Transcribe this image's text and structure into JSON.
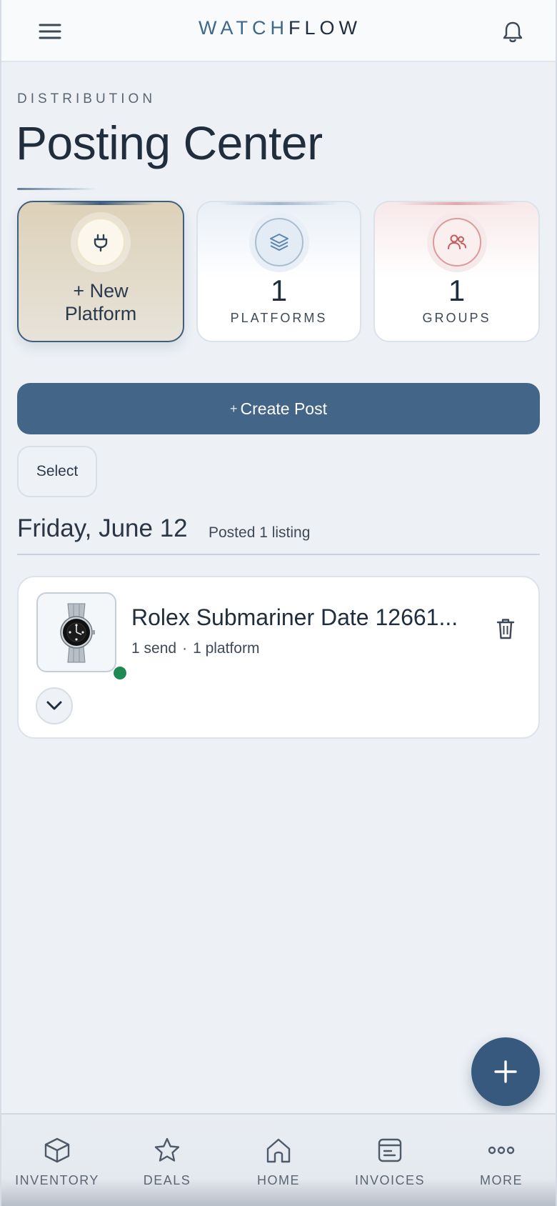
{
  "header": {
    "brand_part1": "WATCH",
    "brand_part2": "FLOW",
    "menu_icon": "hamburger-menu-icon",
    "notification_icon": "bell-icon"
  },
  "page": {
    "eyebrow": "DISTRIBUTION",
    "title": "Posting Center"
  },
  "stats": {
    "new_platform_label_line1": "+ New",
    "new_platform_label_line2": "Platform",
    "platforms_count": "1",
    "platforms_label": "PLATFORMS",
    "groups_count": "1",
    "groups_label": "GROUPS"
  },
  "actions": {
    "create_post_plus": "+",
    "create_post_label": "Create Post",
    "select_label": "Select"
  },
  "day_group": {
    "date": "Friday, June 12",
    "summary": "Posted 1 listing"
  },
  "listings": [
    {
      "title": "Rolex Submariner Date 12661...",
      "sends": "1 send",
      "separator": "·",
      "platforms": "1 platform",
      "status_color": "#1e8a52"
    }
  ],
  "bottom_nav": [
    {
      "label": "INVENTORY",
      "icon": "box-icon"
    },
    {
      "label": "DEALS",
      "icon": "star-icon"
    },
    {
      "label": "HOME",
      "icon": "home-icon"
    },
    {
      "label": "INVOICES",
      "icon": "invoice-icon"
    },
    {
      "label": "MORE",
      "icon": "more-dots-icon"
    }
  ],
  "colors": {
    "accent": "#426588",
    "fab": "#36597d",
    "groups_accent": "#c85a5a",
    "platforms_accent": "#5f86ad"
  }
}
